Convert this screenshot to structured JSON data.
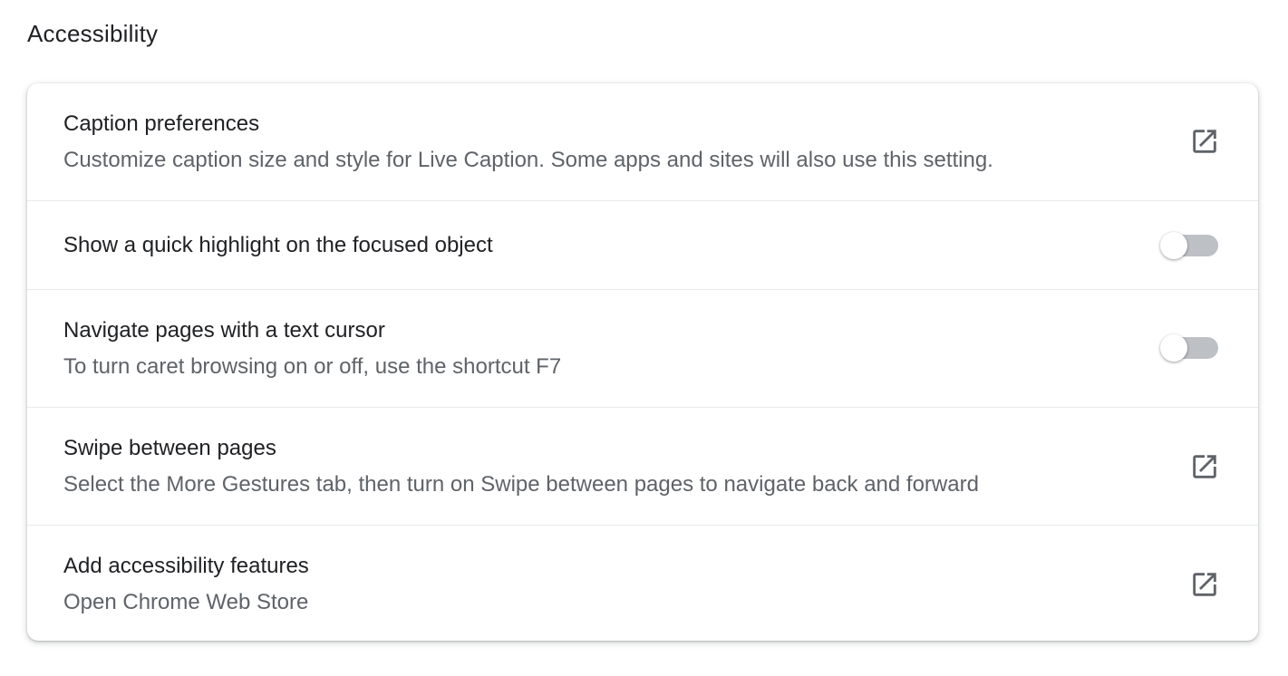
{
  "section": {
    "title": "Accessibility"
  },
  "rows": [
    {
      "title": "Caption preferences",
      "subtitle": "Customize caption size and style for Live Caption. Some apps and sites will also use this setting.",
      "control": "open-in-new-icon"
    },
    {
      "title": "Show a quick highlight on the focused object",
      "control": "toggle",
      "enabled": false
    },
    {
      "title": "Navigate pages with a text cursor",
      "subtitle": "To turn caret browsing on or off, use the shortcut F7",
      "control": "toggle",
      "enabled": false
    },
    {
      "title": "Swipe between pages",
      "subtitle": "Select the More Gestures tab, then turn on Swipe between pages to navigate back and forward",
      "control": "open-in-new-icon"
    },
    {
      "title": "Add accessibility features",
      "subtitle": "Open Chrome Web Store",
      "control": "open-in-new-icon"
    }
  ],
  "colors": {
    "primary_text": "#202124",
    "secondary_text": "#5f6368",
    "divider": "#e8eaed",
    "toggle_off_track": "#bdc1c6",
    "icon": "#5f6368"
  }
}
